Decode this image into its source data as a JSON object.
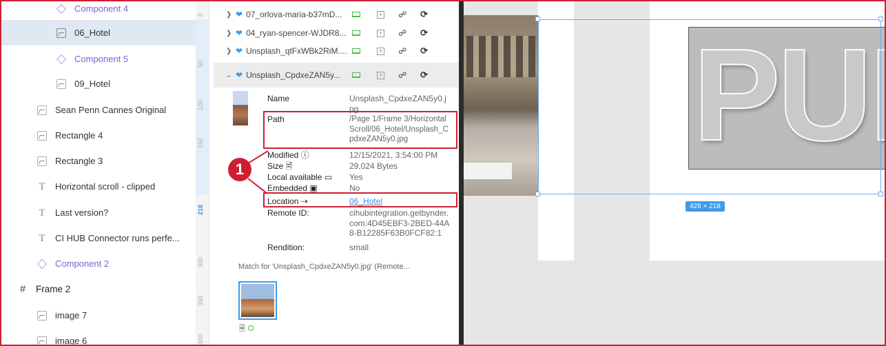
{
  "layers": [
    {
      "label": "Component 4",
      "type": "component",
      "indent": 1
    },
    {
      "label": "06_Hotel",
      "type": "image",
      "indent": 1,
      "selected": true
    },
    {
      "label": "Component 5",
      "type": "component",
      "indent": 1
    },
    {
      "label": "09_Hotel",
      "type": "image",
      "indent": 1
    },
    {
      "label": "Sean Penn Cannes Original",
      "type": "image",
      "indent": 0
    },
    {
      "label": "Rectangle 4",
      "type": "image",
      "indent": 0
    },
    {
      "label": "Rectangle 3",
      "type": "image",
      "indent": 0
    },
    {
      "label": "Horizontal scroll - clipped",
      "type": "text",
      "indent": 0
    },
    {
      "label": "Last version?",
      "type": "text",
      "indent": 0
    },
    {
      "label": "CI HUB Connector runs perfe...",
      "type": "text",
      "indent": 0
    },
    {
      "label": "Component 2",
      "type": "component",
      "indent": 0
    },
    {
      "label": "Frame 2",
      "type": "frame",
      "indent": -1
    },
    {
      "label": "image 7",
      "type": "image",
      "indent": 0
    },
    {
      "label": "image 6",
      "type": "image",
      "indent": 0
    }
  ],
  "ruler": {
    "ticks": [
      "0",
      "50",
      "100",
      "150",
      "218",
      "300",
      "350",
      "400"
    ]
  },
  "assets": {
    "rows": [
      {
        "name": "07_orlova-maria-b37mD..."
      },
      {
        "name": "04_ryan-spencer-WJDR8..."
      },
      {
        "name": "Unsplash_qtFxWBk2RiM...."
      }
    ],
    "active_row": {
      "name": "Unsplash_CpdxeZAN5y..."
    },
    "details": {
      "name_label": "Name",
      "name_value": "Unsplash_CpdxeZAN5y0.jpg",
      "path_label": "Path",
      "path_value": "/Page 1/Frame 3/Horizontal Scroll/06_Hotel/Unsplash_CpdxeZAN5y0.jpg",
      "modified_label": "Modified ⓘ",
      "modified_value": "12/15/2021, 3:54:00 PM",
      "size_label": "Size",
      "size_value": "29,024 Bytes",
      "local_label": "Local available",
      "local_value": "Yes",
      "embedded_label": "Embedded",
      "embedded_value": "No",
      "location_label": "Location",
      "location_value": "06_Hotel",
      "remote_label": "Remote ID:",
      "remote_value": "cihubintegration.getbynder.com:4D45EBF3-2BED-44A8-B12285F63B0FCF82:1",
      "rendition_label": "Rendition:",
      "rendition_value": "small"
    },
    "match_text": "Match for 'Unsplash_CpdxeZAN5y0.jpg' (Remote..."
  },
  "callout": {
    "number": "1"
  },
  "canvas": {
    "frame_text": "PUN",
    "dimension_badge": "428 × 218"
  },
  "colors": {
    "highlight": "#cc1f34",
    "accent": "#3d9be9",
    "component": "#7b61d6"
  }
}
